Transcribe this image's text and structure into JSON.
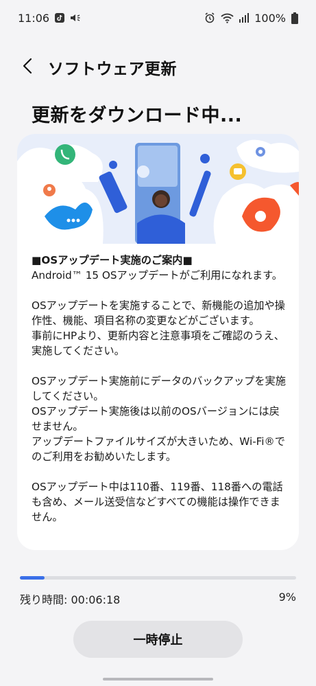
{
  "status_bar": {
    "time": "11:06",
    "battery": "100%",
    "icons": [
      "tiktok-notification-icon",
      "speaker-notification-icon",
      "alarm-icon",
      "wifi-icon",
      "signal-icon",
      "battery-icon"
    ]
  },
  "app_bar": {
    "back_icon": "chevron-left-icon",
    "title": "ソフトウェア更新"
  },
  "headline": "更新をダウンロード中...",
  "notice": {
    "title": "■OSアップデート実施のご案内■",
    "paragraphs": [
      "Android™ 15 OSアップデートがご利用になれます。",
      "OSアップデートを実施することで、新機能の追加や操作性、機能、項目名称の変更などがございます。\n事前にHPより、更新内容と注意事項をご確認のうえ、実施してください。",
      "OSアップデート実施前にデータのバックアップを実施してください。\nOSアップデート実施後は以前のOSバージョンには戻せません。\nアップデートファイルサイズが大きいため、Wi-Fi®でのご利用をお勧めいたします。",
      "OSアップデート中は110番、119番、118番への電話も含め、メール送受信などすべての機能は操作できません。"
    ]
  },
  "progress": {
    "fraction": 0.09,
    "remaining_label": "残り時間: 00:06:18",
    "percent_label": "9%"
  },
  "pause_button": "一時停止",
  "colors": {
    "accent": "#3a6fe8",
    "background": "#f4f4f6",
    "card": "#ffffff"
  }
}
